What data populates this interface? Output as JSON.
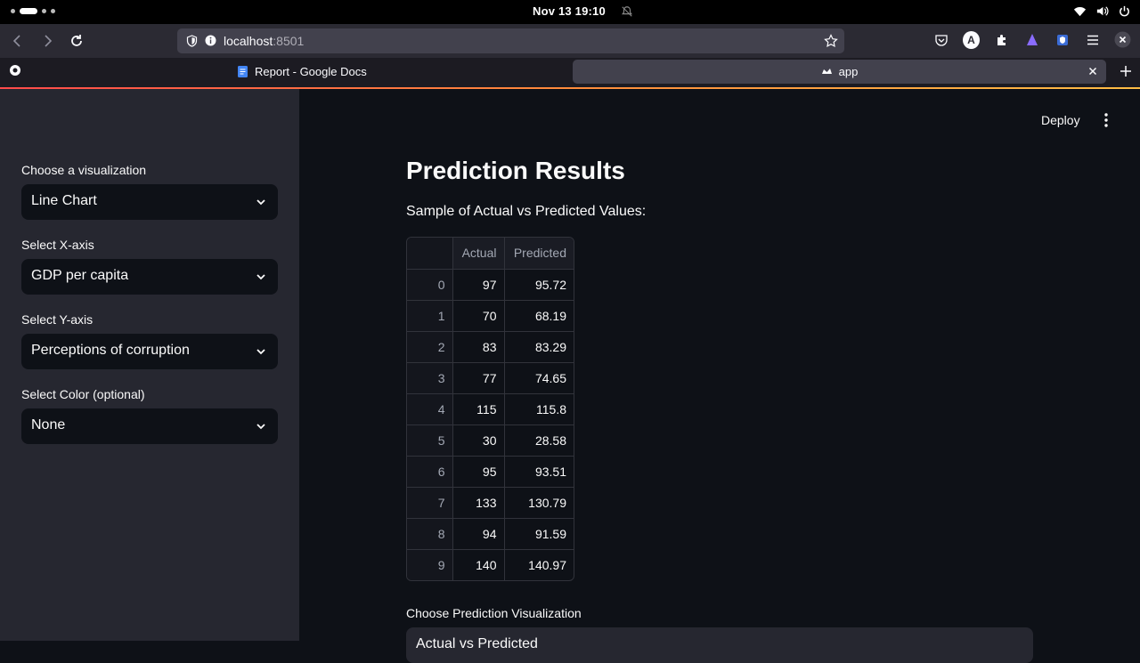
{
  "os": {
    "clock": "Nov 13  19:10"
  },
  "browser": {
    "url_host": "localhost",
    "url_port": ":8501",
    "tabs": [
      {
        "label": "Report - Google Docs",
        "icon": "google-docs-icon"
      },
      {
        "label": "app",
        "icon": "streamlit-icon"
      }
    ],
    "profile_initial": "A"
  },
  "header": {
    "deploy_label": "Deploy"
  },
  "sidebar": {
    "controls": [
      {
        "label": "Choose a visualization",
        "value": "Line Chart"
      },
      {
        "label": "Select X-axis",
        "value": "GDP per capita"
      },
      {
        "label": "Select Y-axis",
        "value": "Perceptions of corruption"
      },
      {
        "label": "Select Color (optional)",
        "value": "None"
      }
    ]
  },
  "main": {
    "title": "Prediction Results",
    "subtitle": "Sample of Actual vs Predicted Values:",
    "table": {
      "columns": [
        "",
        "Actual",
        "Predicted"
      ],
      "rows": [
        [
          "0",
          "97",
          "95.72"
        ],
        [
          "1",
          "70",
          "68.19"
        ],
        [
          "2",
          "83",
          "83.29"
        ],
        [
          "3",
          "77",
          "74.65"
        ],
        [
          "4",
          "115",
          "115.8"
        ],
        [
          "5",
          "30",
          "28.58"
        ],
        [
          "6",
          "95",
          "93.51"
        ],
        [
          "7",
          "133",
          "130.79"
        ],
        [
          "8",
          "94",
          "91.59"
        ],
        [
          "9",
          "140",
          "140.97"
        ]
      ]
    },
    "viz_label": "Choose Prediction Visualization",
    "viz_value": "Actual vs Predicted"
  },
  "colors": {
    "accent": "#ff4b4b",
    "sidebar_bg": "#262730",
    "main_bg": "#0e1117"
  }
}
